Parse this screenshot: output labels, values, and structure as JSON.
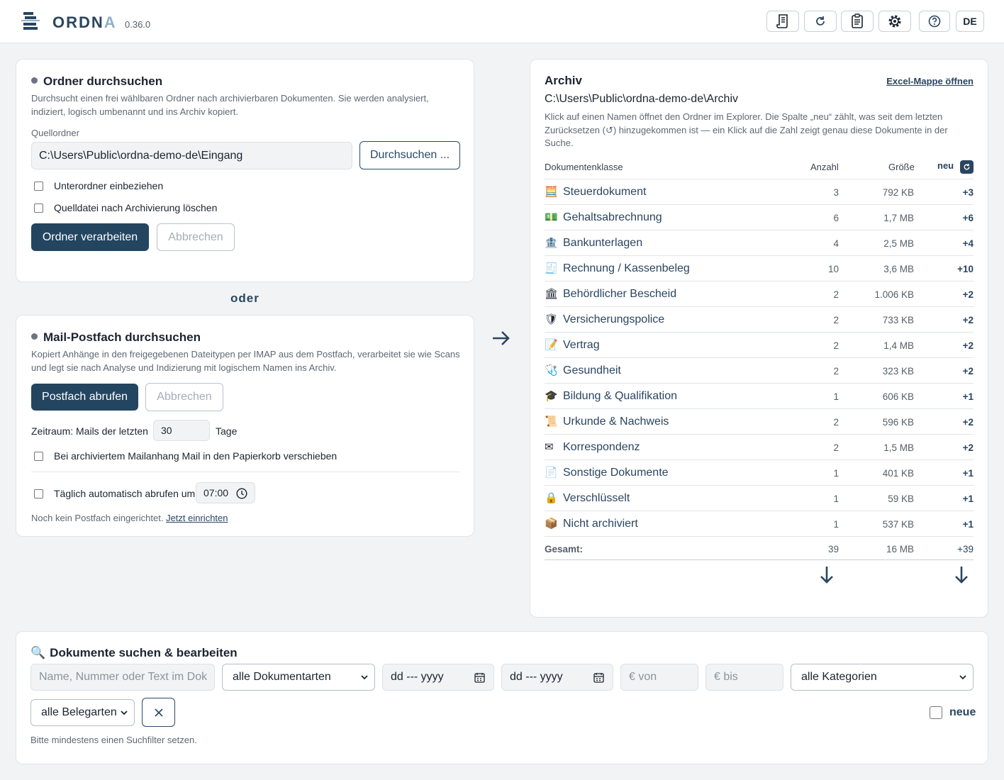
{
  "app": {
    "name_main": "ORDN",
    "name_fade": "A",
    "version": "0.36.0",
    "top_buttons": [
      {
        "icon": "scroll-icon"
      },
      {
        "icon": "refresh-icon"
      },
      {
        "icon": "clipboard-icon"
      },
      {
        "icon": "gear-icon"
      },
      {
        "icon": "help-icon"
      },
      {
        "label": "DE"
      }
    ]
  },
  "folder_card": {
    "title": "Ordner durchsuchen",
    "description": "Durchsucht einen frei wählbaren Ordner nach archivierbaren Dokumenten. Sie werden analysiert, indiziert, logisch umbenannt und ins Archiv kopiert.",
    "source_label": "Quellordner",
    "source_value": "C:\\Users\\Public\\ordna-demo-de\\Eingang",
    "browse_button": "Durchsuchen ...",
    "include_subfolders": "Unterordner einbeziehen",
    "delete_source": "Quelldatei nach Archivierung löschen",
    "process_button": "Ordner verarbeiten",
    "cancel_button": "Abbrechen"
  },
  "or_label": "oder",
  "mail_card": {
    "title": "Mail-Postfach durchsuchen",
    "description": "Kopiert Anhänge in den freigegebenen Dateitypen per IMAP aus dem Postfach, verarbeitet sie wie Scans und legt sie nach Analyse und Indizierung mit logischem Namen ins Archiv.",
    "fetch_button": "Postfach abrufen",
    "cancel_button": "Abbrechen",
    "period_label": "Zeitraum: Mails der letzten",
    "period_value": "30",
    "period_unit": "Tage",
    "trash_option": "Bei archiviertem Mailanhang Mail in den Papierkorb verschieben",
    "daily_option": "Täglich automatisch abrufen um",
    "daily_time": "07:00",
    "no_mailbox_text": "Noch kein Postfach eingerichtet.",
    "setup_link": "Jetzt einrichten"
  },
  "archive": {
    "title": "Archiv",
    "excel_link": "Excel-Mappe öffnen",
    "path": "C:\\Users\\Public\\ordna-demo-de\\Archiv",
    "description": "Klick auf einen Namen öffnet den Ordner im Explorer. Die Spalte „neu“ zählt, was seit dem letzten Zurücksetzen (↺) hinzugekommen ist — ein Klick auf die Zahl zeigt genau diese Dokumente in der Suche.",
    "headers": {
      "class": "Dokumentenklasse",
      "count": "Anzahl",
      "size": "Größe",
      "new": "neu"
    },
    "rows": [
      {
        "icon": "🧮",
        "name": "Steuerdokument",
        "count": "3",
        "size": "792 KB",
        "new": "+3"
      },
      {
        "icon": "💵",
        "name": "Gehaltsabrechnung",
        "count": "6",
        "size": "1,7 MB",
        "new": "+6"
      },
      {
        "icon": "🏦",
        "name": "Bankunterlagen",
        "count": "4",
        "size": "2,5 MB",
        "new": "+4"
      },
      {
        "icon": "🧾",
        "name": "Rechnung / Kassenbeleg",
        "count": "10",
        "size": "3,6 MB",
        "new": "+10"
      },
      {
        "icon": "🏛",
        "name": "Behördlicher Bescheid",
        "count": "2",
        "size": "1.006 KB",
        "new": "+2"
      },
      {
        "icon": "🛡",
        "name": "Versicherungspolice",
        "count": "2",
        "size": "733 KB",
        "new": "+2"
      },
      {
        "icon": "📝",
        "name": "Vertrag",
        "count": "2",
        "size": "1,4 MB",
        "new": "+2"
      },
      {
        "icon": "🩺",
        "name": "Gesundheit",
        "count": "2",
        "size": "323 KB",
        "new": "+2"
      },
      {
        "icon": "🎓",
        "name": "Bildung & Qualifikation",
        "count": "1",
        "size": "606 KB",
        "new": "+1"
      },
      {
        "icon": "📜",
        "name": "Urkunde & Nachweis",
        "count": "2",
        "size": "596 KB",
        "new": "+2"
      },
      {
        "icon": "✉",
        "name": "Korrespondenz",
        "count": "2",
        "size": "1,5 MB",
        "new": "+2"
      },
      {
        "icon": "📄",
        "name": "Sonstige Dokumente",
        "count": "1",
        "size": "401 KB",
        "new": "+1"
      },
      {
        "icon": "🔒",
        "name": "Verschlüsselt",
        "count": "1",
        "size": "59 KB",
        "new": "+1"
      },
      {
        "icon": "📦",
        "name": "Nicht archiviert",
        "count": "1",
        "size": "537 KB",
        "new": "+1"
      }
    ],
    "total": {
      "label": "Gesamt:",
      "count": "39",
      "size": "16 MB",
      "new": "+39"
    }
  },
  "search": {
    "title": "Dokumente suchen & bearbeiten",
    "text_placeholder": "Name, Nummer oder Text im Dok",
    "doc_type": "alle Dokumentarten",
    "date_from": "dd --- yyyy",
    "date_to": "dd --- yyyy",
    "amount_from": "€ von",
    "amount_to": "€ bis",
    "category": "alle Kategorien",
    "receipt_type": "alle Belegarten",
    "new_label": "neue",
    "hint": "Bitte mindestens einen Suchfilter setzen."
  },
  "colors": {
    "primary": "#234560",
    "accent_text": "#2a4560",
    "background": "#f1f3f5"
  }
}
